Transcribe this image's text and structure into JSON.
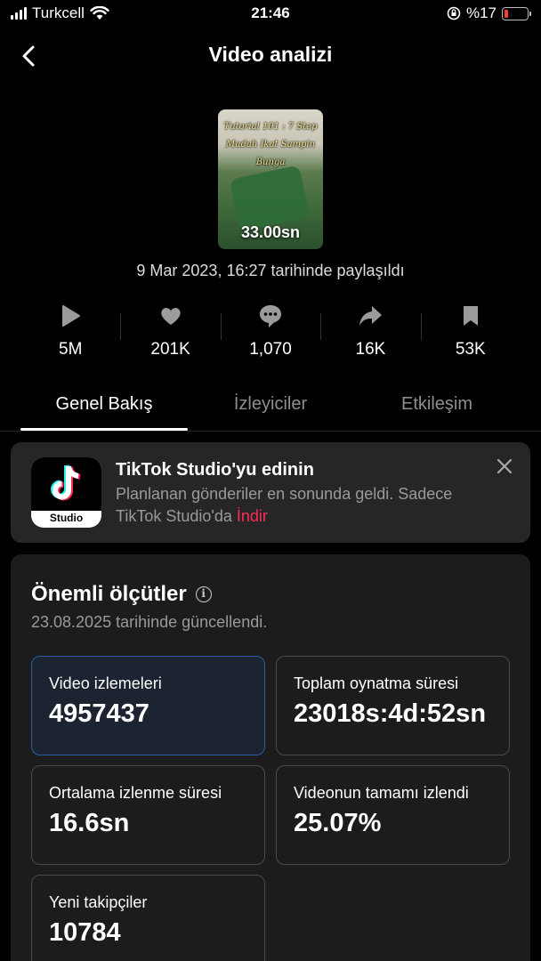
{
  "status_bar": {
    "carrier": "Turkcell",
    "time": "21:46",
    "battery": "%17",
    "battery_level": 0.17
  },
  "header": {
    "title": "Video analizi"
  },
  "video": {
    "thumbnail_caption": "Tutorial 101 : 7 Step Mudah Ikat Sampin Bunga",
    "duration": "33.00sn",
    "shared": "9 Mar 2023, 16:27 tarihinde paylaşıldı"
  },
  "stats": [
    {
      "icon": "play-icon",
      "value": "5M"
    },
    {
      "icon": "heart-icon",
      "value": "201K"
    },
    {
      "icon": "comment-icon",
      "value": "1,070"
    },
    {
      "icon": "share-icon",
      "value": "16K"
    },
    {
      "icon": "bookmark-icon",
      "value": "53K"
    }
  ],
  "tabs": [
    {
      "label": "Genel Bakış",
      "active": true
    },
    {
      "label": "İzleyiciler",
      "active": false
    },
    {
      "label": "Etkileşim",
      "active": false
    }
  ],
  "banner": {
    "title": "TikTok Studio'yu edinin",
    "text": "Planlanan gönderiler en sonunda geldi. Sadece TikTok Studio'da ",
    "link": "İndir",
    "app_label": "Studio"
  },
  "metrics": {
    "title": "Önemli ölçütler",
    "updated": "23.08.2025 tarihinde güncellendi.",
    "cards": [
      {
        "label": "Video izlemeleri",
        "value": "4957437"
      },
      {
        "label": "Toplam oynatma süresi",
        "value": "23018s:4d:52sn"
      },
      {
        "label": "Ortalama izlenme süresi",
        "value": "16.6sn"
      },
      {
        "label": "Videonun tamamı izlendi",
        "value": "25.07%"
      },
      {
        "label": "Yeni takipçiler",
        "value": "10784"
      }
    ]
  },
  "colors": {
    "accent_link": "#fe2c55",
    "selected_card_border": "#2a5fa8",
    "battery_low": "#ff3b30"
  }
}
